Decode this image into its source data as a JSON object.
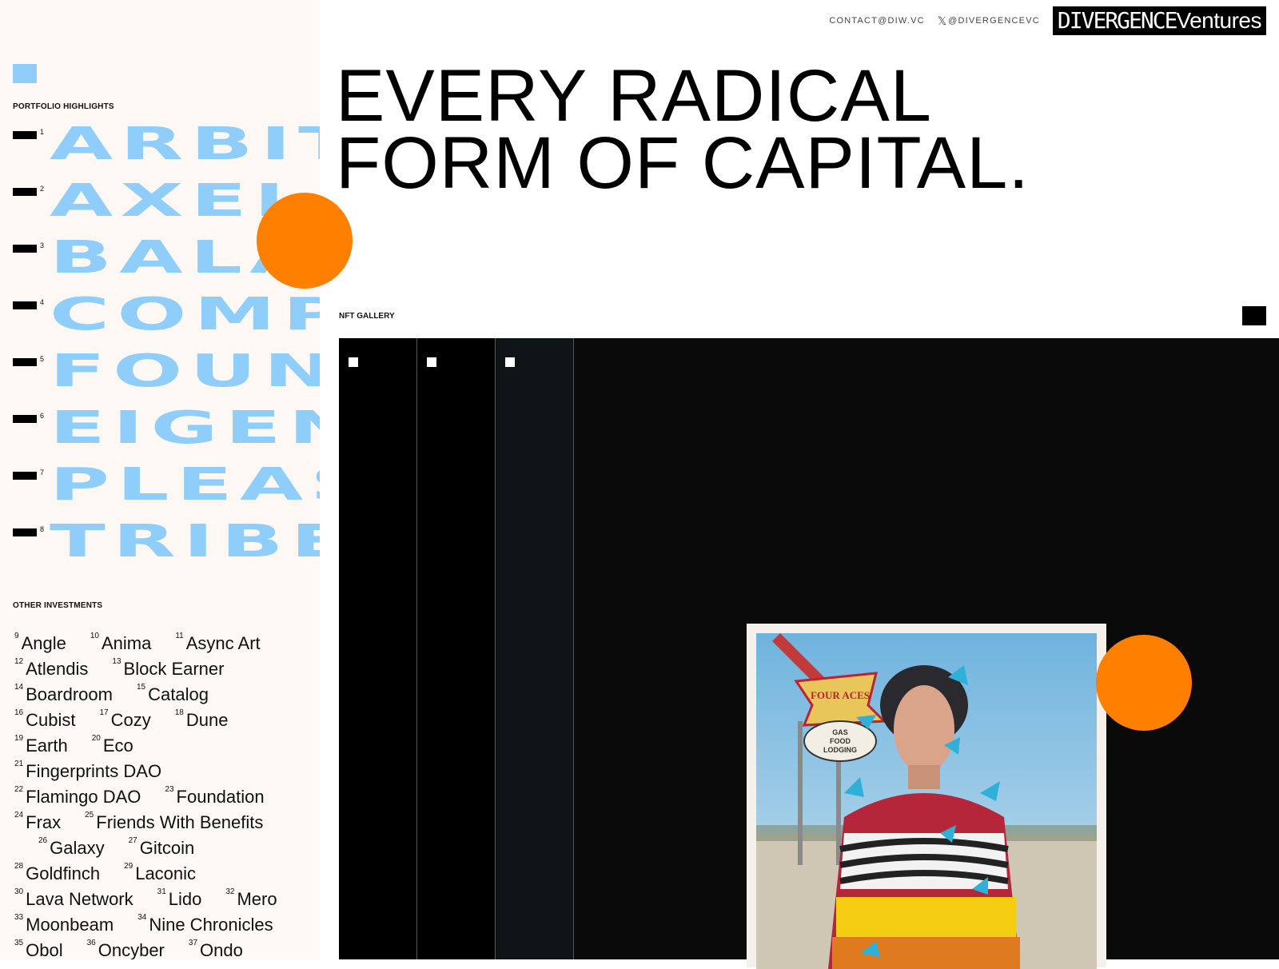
{
  "nav": {
    "email": "CONTACT@DIW.VC",
    "twitter": "@DIVERGENCEVC",
    "brand_part1": "DIVERGENCE",
    "brand_part2": "Ventures"
  },
  "headline": {
    "line1": "EVERY RADICAL",
    "line2": "FORM OF CAPITAL."
  },
  "sidebar": {
    "highlights_label": "PORTFOLIO HIGHLIGHTS",
    "highlights": [
      {
        "num": "1",
        "name": "ARBITRUM"
      },
      {
        "num": "2",
        "name": "AXELAR"
      },
      {
        "num": "3",
        "name": "BALANCER"
      },
      {
        "num": "4",
        "name": "COMPOUND"
      },
      {
        "num": "5",
        "name": "FOUNDRY"
      },
      {
        "num": "6",
        "name": "EIGENLAYER"
      },
      {
        "num": "7",
        "name": "PLEASR"
      },
      {
        "num": "8",
        "name": "TRIBE"
      }
    ],
    "others_label": "OTHER INVESTMENTS",
    "investments": [
      [
        {
          "n": "9",
          "t": "Angle"
        },
        {
          "n": "10",
          "t": "Anima"
        },
        {
          "n": "11",
          "t": "Async Art"
        }
      ],
      [
        {
          "n": "12",
          "t": "Atlendis"
        },
        {
          "n": "13",
          "t": "Block Earner"
        }
      ],
      [
        {
          "n": "14",
          "t": "Boardroom"
        },
        {
          "n": "15",
          "t": "Catalog"
        }
      ],
      [
        {
          "n": "16",
          "t": "Cubist"
        },
        {
          "n": "17",
          "t": "Cozy"
        },
        {
          "n": "18",
          "t": "Dune"
        }
      ],
      [
        {
          "n": "19",
          "t": "Earth"
        },
        {
          "n": "20",
          "t": "Eco"
        }
      ],
      [
        {
          "n": "21",
          "t": "Fingerprints DAO"
        }
      ],
      [
        {
          "n": "22",
          "t": "Flamingo DAO"
        },
        {
          "n": "23",
          "t": "Foundation"
        }
      ],
      [
        {
          "n": "24",
          "t": "Frax"
        },
        {
          "n": "25",
          "t": "Friends With Benefits"
        }
      ],
      [
        {
          "n": "26",
          "t": "Galaxy"
        },
        {
          "n": "27",
          "t": "Gitcoin"
        }
      ],
      [
        {
          "n": "28",
          "t": "Goldfinch"
        },
        {
          "n": "29",
          "t": "Laconic"
        }
      ],
      [
        {
          "n": "30",
          "t": "Lava Network"
        },
        {
          "n": "31",
          "t": "Lido"
        },
        {
          "n": "32",
          "t": "Mero"
        }
      ],
      [
        {
          "n": "33",
          "t": "Moonbeam"
        },
        {
          "n": "34",
          "t": "Nine Chronicles"
        }
      ],
      [
        {
          "n": "35",
          "t": "Obol"
        },
        {
          "n": "36",
          "t": "Oncyber"
        },
        {
          "n": "37",
          "t": "Ondo"
        }
      ]
    ]
  },
  "gallery": {
    "label": "NFT GALLERY",
    "tab_count": 3,
    "sign_top": "FOUR ACES",
    "sign_bottom": [
      "GAS",
      "FOOD",
      "LODGING"
    ]
  },
  "colors": {
    "accent_blue": "#8fcdfb",
    "accent_orange": "#ff7f00",
    "sidebar_bg": "#fdf8f4"
  }
}
